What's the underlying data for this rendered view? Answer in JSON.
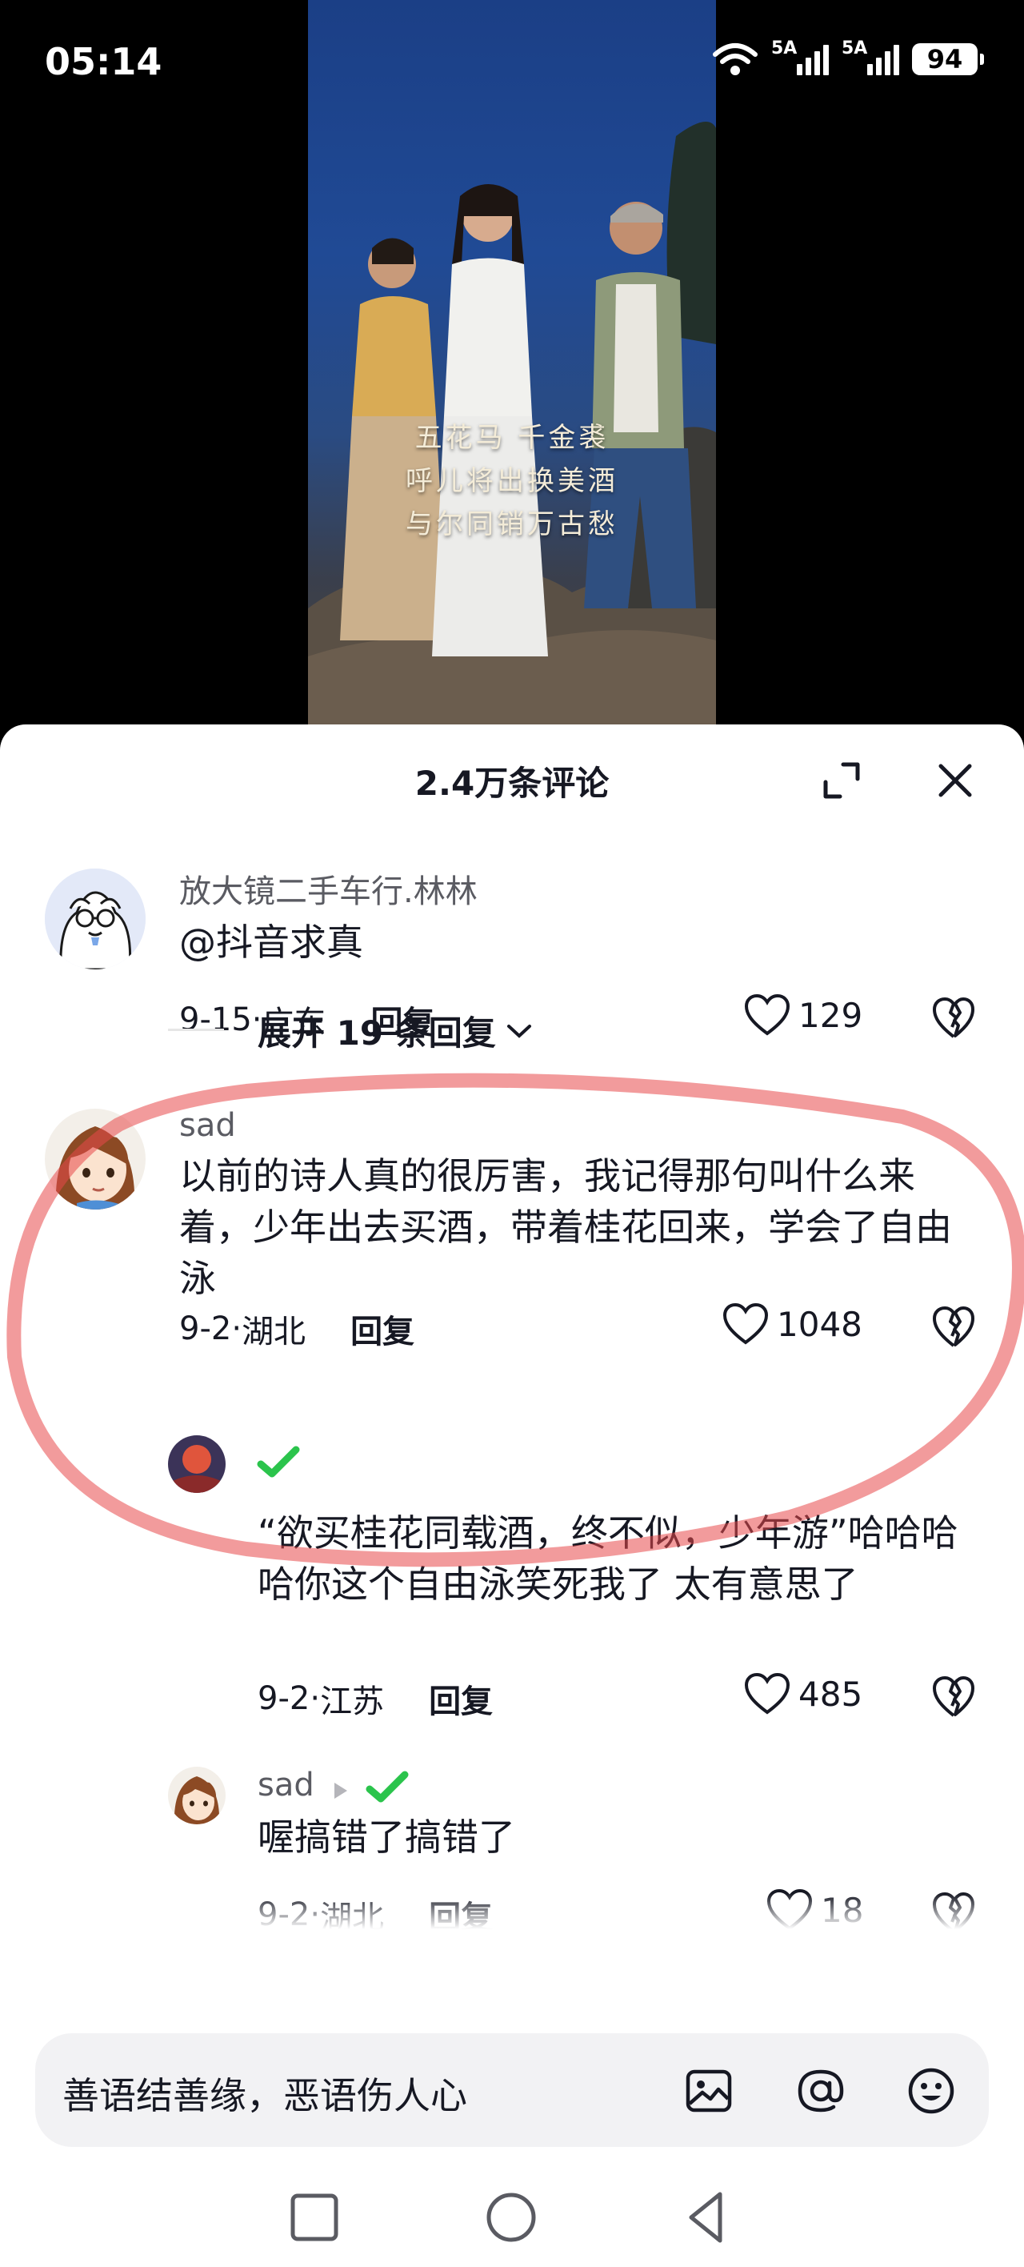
{
  "status_bar": {
    "time": "05:14",
    "network_1": "5A",
    "network_2": "5A",
    "battery": "94"
  },
  "video": {
    "poem_lines": [
      "五花马 千金裘",
      "呼儿将出换美酒",
      "与尔同销万古愁"
    ]
  },
  "sheet": {
    "title": "2.4万条评论"
  },
  "comments": [
    {
      "user": "放大镜二手车行.林林",
      "text": "@抖音求真",
      "date": "9-15",
      "location": "广东",
      "reply_label": "回复",
      "likes": "129"
    },
    {
      "expand_label": "展开 19 条回复"
    },
    {
      "user": "sad",
      "text": "以前的诗人真的很厉害，我记得那句叫什么来着，少年出去买酒，带着桂花回来，学会了自由泳",
      "date": "9-2",
      "location": "湖北",
      "reply_label": "回复",
      "likes": "1048"
    },
    {
      "user": "",
      "text": "“欲买桂花同载酒，终不似，少年游”哈哈哈哈你这个自由泳笑死我了 太有意思了",
      "date": "9-2",
      "location": "江苏",
      "reply_label": "回复",
      "likes": "485"
    },
    {
      "user": "sad",
      "text": "喔搞错了搞错了",
      "date": "9-2",
      "location": "湖北",
      "reply_label": "回复",
      "likes": "18"
    }
  ],
  "input": {
    "placeholder": "善语结善缘，恶语伤人心"
  },
  "colors": {
    "accent_green": "#2bc44c",
    "highlight_red": "#e8484a",
    "text": "#161823",
    "muted": "#5a5b62"
  }
}
